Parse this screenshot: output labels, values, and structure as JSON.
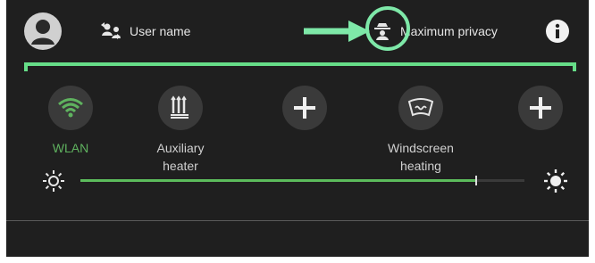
{
  "header": {
    "user_label": "User name",
    "privacy_label": "Maximum privacy",
    "icons": {
      "avatar": "user-avatar-icon",
      "switch_user": "switch-user-icon",
      "privacy": "incognito-icon",
      "info": "info-icon"
    }
  },
  "highlight": {
    "color": "#7ee8a8",
    "bracket_color": "#66dd88"
  },
  "tiles": [
    {
      "line1": "WLAN",
      "line2": "",
      "icon": "wifi-icon",
      "active": true
    },
    {
      "line1": "Auxiliary",
      "line2": "heater",
      "icon": "auxiliary-heater-icon",
      "active": false
    },
    {
      "line1": "",
      "line2": "",
      "icon": "plus-icon",
      "active": false
    },
    {
      "line1": "Windscreen",
      "line2": "heating",
      "icon": "windscreen-heating-icon",
      "active": false
    },
    {
      "line1": "",
      "line2": "",
      "icon": "plus-icon",
      "active": false
    }
  ],
  "brightness": {
    "level": 0.89,
    "min_icon": "brightness-low-icon",
    "max_icon": "brightness-high-icon"
  },
  "colors": {
    "background": "#1f1f1f",
    "active": "#5fb25f",
    "tile_bg": "#3a3a3a"
  }
}
